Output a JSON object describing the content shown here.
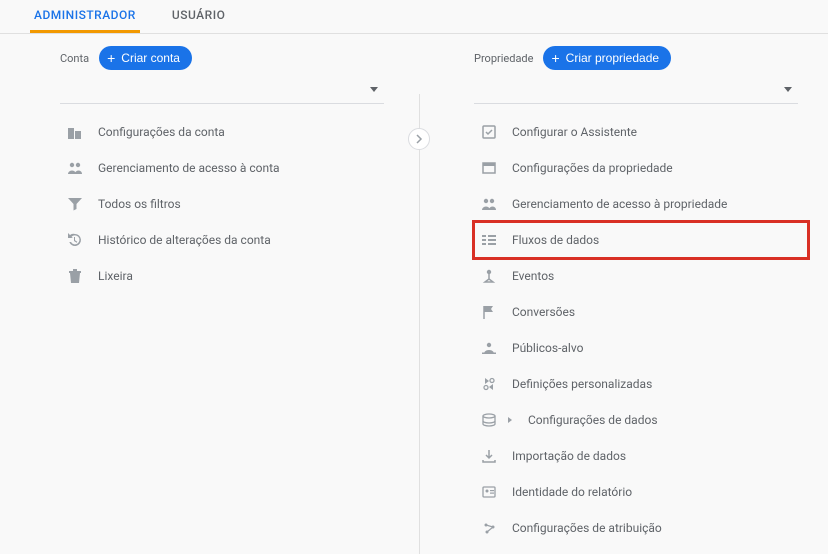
{
  "tabs": {
    "admin": "ADMINISTRADOR",
    "user": "USUÁRIO"
  },
  "account": {
    "label": "Conta",
    "create_btn": "Criar conta",
    "items": [
      {
        "icon": "building",
        "label": "Configurações da conta"
      },
      {
        "icon": "people",
        "label": "Gerenciamento de acesso à conta"
      },
      {
        "icon": "filter",
        "label": "Todos os filtros"
      },
      {
        "icon": "history",
        "label": "Histórico de alterações da conta"
      },
      {
        "icon": "trash",
        "label": "Lixeira"
      }
    ]
  },
  "property": {
    "label": "Propriedade",
    "create_btn": "Criar propriedade",
    "items": [
      {
        "icon": "assistant",
        "label": "Configurar o Assistente"
      },
      {
        "icon": "settings-box",
        "label": "Configurações da propriedade"
      },
      {
        "icon": "people",
        "label": "Gerenciamento de acesso à propriedade"
      },
      {
        "icon": "data-streams",
        "label": "Fluxos de dados",
        "highlight": true
      },
      {
        "icon": "events",
        "label": "Eventos"
      },
      {
        "icon": "flag",
        "label": "Conversões"
      },
      {
        "icon": "audience",
        "label": "Públicos-alvo"
      },
      {
        "icon": "custom",
        "label": "Definições personalizadas"
      },
      {
        "icon": "data-settings",
        "label": "Configurações de dados",
        "expandable": true
      },
      {
        "icon": "import",
        "label": "Importação de dados"
      },
      {
        "icon": "identity",
        "label": "Identidade do relatório"
      },
      {
        "icon": "attribution",
        "label": "Configurações de atribuição"
      }
    ]
  }
}
